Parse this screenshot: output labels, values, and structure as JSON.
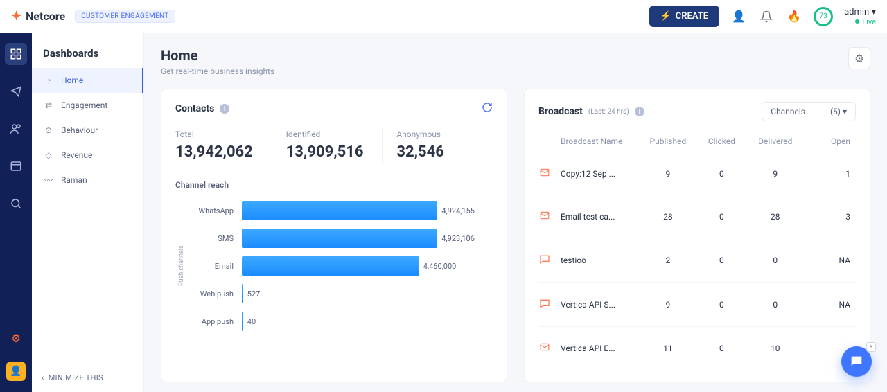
{
  "brand": {
    "name": "Netcore",
    "tagline": "CUSTOMER ENGAGEMENT"
  },
  "topbar": {
    "create": "CREATE",
    "ring_value": "73",
    "admin": "admin",
    "status": "Live"
  },
  "sidebar": {
    "title": "Dashboards",
    "items": [
      {
        "label": "Home",
        "active": true
      },
      {
        "label": "Engagement"
      },
      {
        "label": "Behaviour"
      },
      {
        "label": "Revenue"
      },
      {
        "label": "Raman"
      }
    ],
    "minimize": "MINIMIZE THIS"
  },
  "page": {
    "title": "Home",
    "subtitle": "Get real-time business insights"
  },
  "contacts": {
    "title": "Contacts",
    "stats": {
      "total_label": "Total",
      "total": "13,942,062",
      "identified_label": "Identified",
      "identified": "13,909,516",
      "anon_label": "Anonymous",
      "anon": "32,546"
    },
    "chart_title": "Channel reach",
    "ylabel": "Push channels"
  },
  "chart_data": {
    "type": "bar",
    "orientation": "horizontal",
    "title": "Channel reach",
    "xlabel": "",
    "ylabel": "Push channels",
    "categories": [
      "WhatsApp",
      "SMS",
      "Email",
      "Web push",
      "App push"
    ],
    "values": [
      4924155,
      4923106,
      4460000,
      527,
      40
    ],
    "value_labels": [
      "4,924,155",
      "4,923,106",
      "4,460,000",
      "527",
      "40"
    ],
    "xlim": [
      0,
      5000000
    ]
  },
  "broadcast": {
    "title": "Broadcast",
    "period": "(Last: 24 hrs)",
    "channel_label": "Channels",
    "channel_count": "(5)",
    "columns": [
      "Broadcast Name",
      "Published",
      "Clicked",
      "Delivered",
      "Open"
    ],
    "rows": [
      {
        "icon": "email",
        "name": "Copy:12 Sep ...",
        "published": "9",
        "clicked": "0",
        "delivered": "9",
        "open": "1"
      },
      {
        "icon": "email",
        "name": "Email test ca...",
        "published": "28",
        "clicked": "0",
        "delivered": "28",
        "open": "3"
      },
      {
        "icon": "sms",
        "name": "testioo",
        "published": "2",
        "clicked": "0",
        "delivered": "0",
        "open": "NA"
      },
      {
        "icon": "sms",
        "name": "Vertica API S...",
        "published": "9",
        "clicked": "0",
        "delivered": "0",
        "open": "NA"
      },
      {
        "icon": "email",
        "name": "Vertica API E...",
        "published": "11",
        "clicked": "0",
        "delivered": "10",
        "open": ""
      }
    ]
  }
}
